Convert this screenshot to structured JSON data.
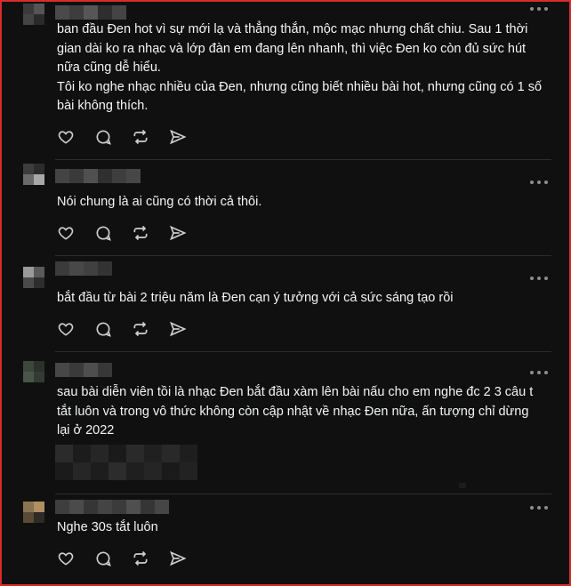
{
  "posts": [
    {
      "text": "ban đầu Đen hot vì sự mới lạ và thẳng thắn, mộc mạc nhưng chất chiu. Sau 1 thời gian dài ko ra nhạc và lớp đàn em đang lên nhanh, thì việc Đen ko còn đủ sức hút nữa cũng dễ hiểu.\nTôi ko nghe nhạc nhiều của Đen, nhưng cũng biết nhiều bài hot, nhưng cũng có 1 số bài không thích."
    },
    {
      "text": "Nói chung là ai cũng có thời cả thôi."
    },
    {
      "text": "bắt đầu từ bài 2 triệu năm là Đen cạn ý tưởng với cả sức sáng tạo rồi"
    },
    {
      "text": "sau bài diễn viên tồi là nhạc Đen bắt đầu xàm    lên bài nấu cho em nghe đc 2 3 câu t tắt luôn và trong vô thức không còn cập nhật về nhạc Đen nữa, ấn tượng chỉ dừng lại ở 2022"
    },
    {
      "text": "Nghe 30s tắt luôn"
    }
  ],
  "actions": [
    "heart-icon",
    "comment-icon",
    "repost-icon",
    "share-icon"
  ],
  "colors": {
    "background": "#101010",
    "text": "#f3f5f7",
    "icon": "#cfcfcf",
    "border": "#d92b2b"
  }
}
